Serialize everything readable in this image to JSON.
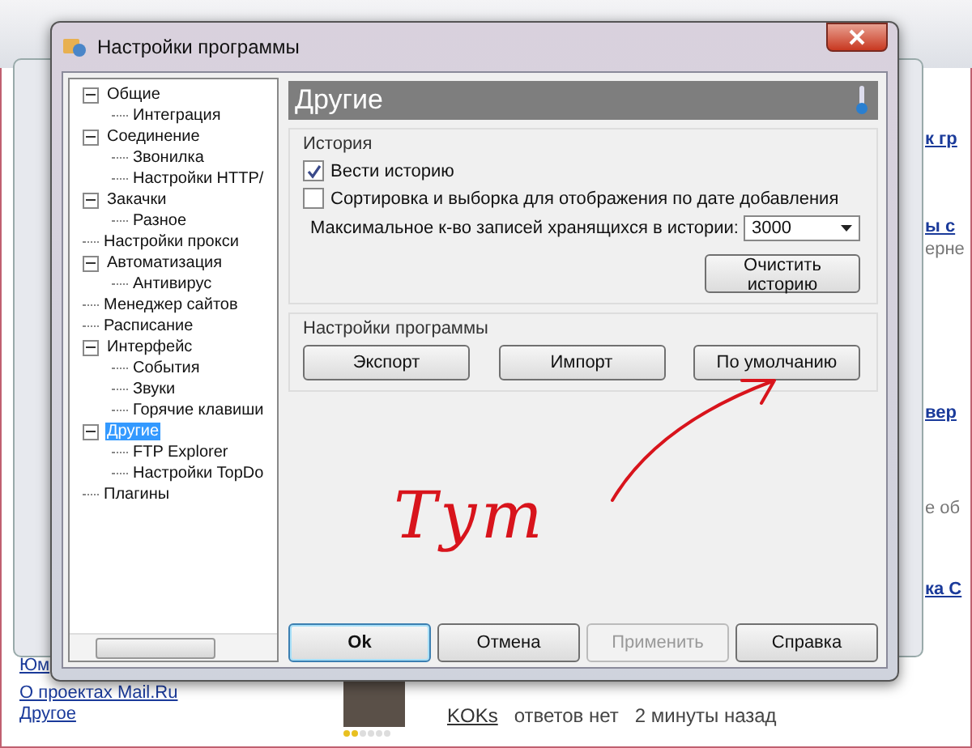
{
  "background_links": [
    "Юм",
    "О проектах Mail.Ru",
    "Другое"
  ],
  "background_post": {
    "author": "KOKs",
    "answers": "ответов нет",
    "time": "2 минуты назад",
    "stars": 2
  },
  "background_fragments": [
    "к гр",
    "ы с",
    "ерне",
    "вер",
    "е об",
    "ка С"
  ],
  "window": {
    "title": "Настройки программы"
  },
  "tree": [
    {
      "label": "Общие",
      "expanded": true,
      "selected": false,
      "children": [
        {
          "label": "Интеграция",
          "selected": false
        }
      ]
    },
    {
      "label": "Соединение",
      "expanded": true,
      "selected": false,
      "children": [
        {
          "label": "Звонилка",
          "selected": false
        },
        {
          "label": "Настройки HTTP/",
          "selected": false
        }
      ]
    },
    {
      "label": "Закачки",
      "expanded": true,
      "selected": false,
      "children": [
        {
          "label": "Разное",
          "selected": false
        }
      ]
    },
    {
      "label": "Настройки прокси",
      "selected": false
    },
    {
      "label": "Автоматизация",
      "expanded": true,
      "selected": false,
      "children": [
        {
          "label": "Антивирус",
          "selected": false
        }
      ]
    },
    {
      "label": "Менеджер сайтов",
      "selected": false
    },
    {
      "label": "Расписание",
      "selected": false
    },
    {
      "label": "Интерфейс",
      "expanded": true,
      "selected": false,
      "children": [
        {
          "label": "События",
          "selected": false
        },
        {
          "label": "Звуки",
          "selected": false
        },
        {
          "label": "Горячие клавиши",
          "selected": false
        }
      ]
    },
    {
      "label": "Другие",
      "expanded": true,
      "selected": true,
      "children": [
        {
          "label": "FTP Explorer",
          "selected": false
        },
        {
          "label": "Настройки TopDo",
          "selected": false
        }
      ]
    },
    {
      "label": "Плагины",
      "selected": false
    }
  ],
  "panel": {
    "title": "Другие",
    "history": {
      "title": "История",
      "checkboxes": [
        {
          "label": "Вести историю",
          "checked": true
        },
        {
          "label": "Сортировка и выборка для отображения по дате добавления",
          "checked": false
        }
      ],
      "max_records": {
        "label": "Максимальное к-во записей хранящихся в истории:",
        "value": "3000"
      },
      "clear_button": "Очистить историю"
    },
    "settings": {
      "title": "Настройки программы",
      "buttons": [
        "Экспорт",
        "Импорт",
        "По умолчанию"
      ]
    }
  },
  "footer_buttons": [
    {
      "label": "Ok",
      "default": true,
      "disabled": false
    },
    {
      "label": "Отмена",
      "default": false,
      "disabled": false
    },
    {
      "label": "Применить",
      "default": false,
      "disabled": true
    },
    {
      "label": "Справка",
      "default": false,
      "disabled": false
    }
  ],
  "annotation": {
    "text": "Тут"
  }
}
